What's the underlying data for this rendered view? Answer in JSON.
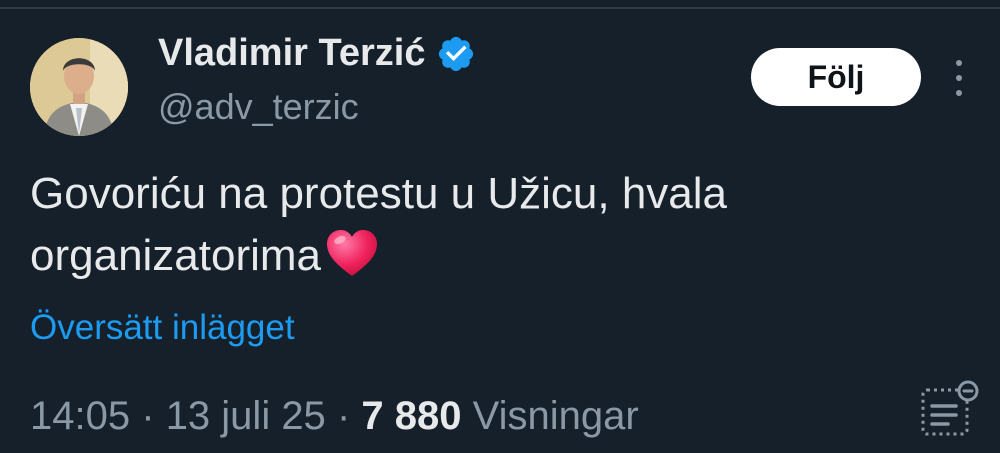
{
  "tweet": {
    "author": {
      "display_name": "Vladimir Terzić",
      "handle": "@adv_terzic",
      "verified": true
    },
    "follow_label": "Följ",
    "text_line1": "Govoriću na protestu u Užicu, hvala",
    "text_line2": "organizatorima",
    "emoji": "heart",
    "translate_label": "Översätt inlägget",
    "time": "14:05",
    "separator": "·",
    "date": "13 juli 25",
    "views_count": "7 880",
    "views_label": "Visningar"
  },
  "colors": {
    "background": "#15202b",
    "text_primary": "#e7e9ea",
    "text_secondary": "#8b98a5",
    "accent": "#1d9bf0",
    "heart": "#f91880"
  },
  "icons": [
    "verified-badge-icon",
    "more-options-icon",
    "heart-emoji-icon",
    "post-analytics-icon"
  ]
}
